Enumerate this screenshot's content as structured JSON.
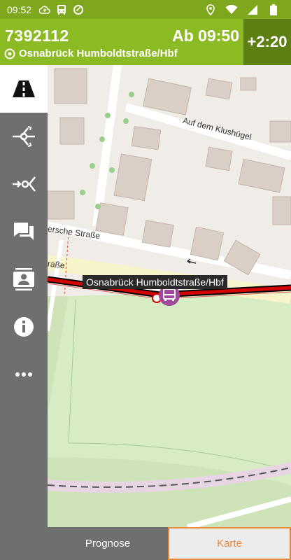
{
  "status_bar": {
    "time": "09:52",
    "icons_left": [
      "cloud-upload-icon",
      "bus-status-icon",
      "data-saver-icon"
    ],
    "icons_right": [
      "location-icon",
      "wifi-icon",
      "signal-icon",
      "battery-icon"
    ]
  },
  "header": {
    "trip_number": "7392112",
    "departure": "Ab 09:50",
    "stop_name": "Osnabrück Humboldtstraße/Hbf",
    "delay": "+2:20",
    "colors": {
      "header": "#8cba22",
      "status_bar": "#7fa71d",
      "delay_box": "#5d7f14"
    }
  },
  "sidebar": {
    "items": [
      {
        "name": "road-icon",
        "active": true
      },
      {
        "name": "route-branch-icon",
        "active": false
      },
      {
        "name": "route-merge-icon",
        "active": false
      },
      {
        "name": "messages-icon",
        "active": false
      },
      {
        "name": "contact-card-icon",
        "active": false
      },
      {
        "name": "info-icon",
        "active": false
      },
      {
        "name": "more-icon",
        "active": false
      }
    ]
  },
  "map": {
    "stop_label": "Osnabrück Humboldtstraße/Hbf",
    "streets": [
      "Auf dem Klushügel",
      "ersche Straße",
      "raße"
    ],
    "route_color": "#d40000",
    "stop_marker_color": "#a0489a"
  },
  "tabs": [
    {
      "label": "Prognose",
      "active": false
    },
    {
      "label": "Karte",
      "active": true
    }
  ]
}
